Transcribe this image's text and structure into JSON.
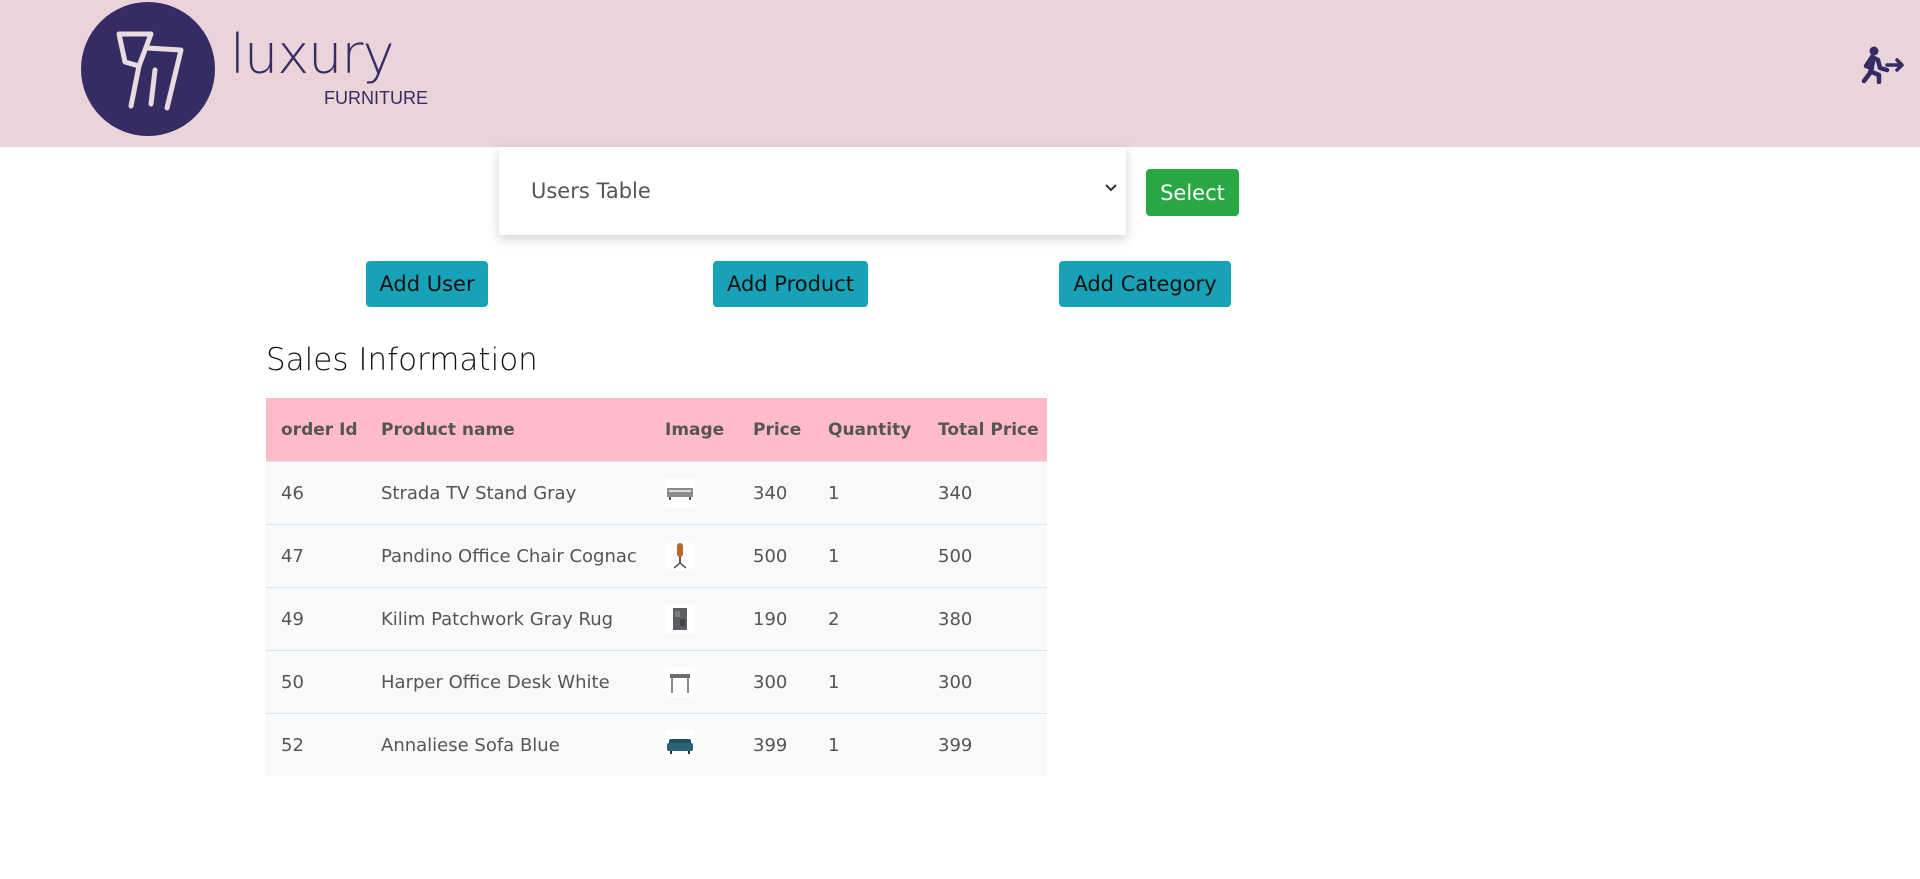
{
  "header": {
    "logo_word": "luxury",
    "logo_sub": "FURNITURE"
  },
  "controls": {
    "table_select_value": "Users Table",
    "select_button": "Select",
    "add_user": "Add User",
    "add_product": "Add Product",
    "add_category": "Add Category"
  },
  "sales": {
    "title": "Sales Information",
    "columns": [
      "order Id",
      "Product name",
      "Image",
      "Price",
      "Quantity",
      "Total Price"
    ],
    "rows": [
      {
        "order_id": "46",
        "name": "Strada TV Stand Gray",
        "image_icon": "tv-stand-icon",
        "price": "340",
        "quantity": "1",
        "total": "340"
      },
      {
        "order_id": "47",
        "name": "Pandino Office Chair Cognac",
        "image_icon": "office-chair-icon",
        "price": "500",
        "quantity": "1",
        "total": "500"
      },
      {
        "order_id": "49",
        "name": "Kilim Patchwork Gray Rug",
        "image_icon": "rug-icon",
        "price": "190",
        "quantity": "2",
        "total": "380"
      },
      {
        "order_id": "50",
        "name": "Harper Office Desk White",
        "image_icon": "desk-icon",
        "price": "300",
        "quantity": "1",
        "total": "300"
      },
      {
        "order_id": "52",
        "name": "Annaliese Sofa Blue",
        "image_icon": "sofa-icon",
        "price": "399",
        "quantity": "1",
        "total": "399"
      }
    ]
  },
  "colors": {
    "header_bg": "#e8d4d9",
    "brand": "#362b63",
    "select_button": "#28a745",
    "action_button": "#17a2b8",
    "table_head": "#ffbcc8"
  }
}
